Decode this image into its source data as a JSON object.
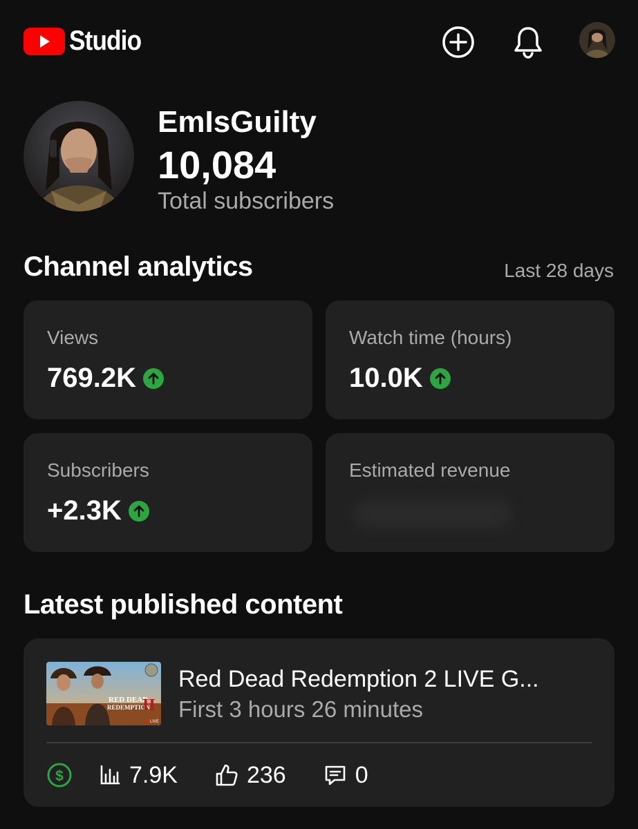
{
  "header": {
    "logo_text": "Studio",
    "icons": [
      "create-plus-icon",
      "notifications-bell-icon",
      "account-avatar"
    ]
  },
  "channel": {
    "name": "EmIsGuilty",
    "subscriber_count": "10,084",
    "subscriber_label": "Total subscribers"
  },
  "analytics": {
    "title": "Channel analytics",
    "range": "Last 28 days",
    "cards": [
      {
        "label": "Views",
        "value": "769.2K",
        "trend": "up"
      },
      {
        "label": "Watch time (hours)",
        "value": "10.0K",
        "trend": "up"
      },
      {
        "label": "Subscribers",
        "value": "+2.3K",
        "trend": "up"
      },
      {
        "label": "Estimated revenue",
        "value": "",
        "trend": "hidden"
      }
    ]
  },
  "latest": {
    "title": "Latest published content",
    "video": {
      "title": "Red Dead Redemption 2 LIVE G...",
      "subtitle": "First 3 hours 26 minutes",
      "thumb_text_line1": "RED DEAD",
      "thumb_text_line2": "REDEMPTION",
      "thumb_numeral": "II",
      "thumb_badge": "LIVE",
      "views": "7.9K",
      "likes": "236",
      "comments": "0"
    }
  },
  "colors": {
    "background": "#0f0f0f",
    "card": "#212121",
    "brand_red": "#ff0000",
    "trend_green": "#2ba640",
    "muted_text": "#aaaaaa"
  }
}
